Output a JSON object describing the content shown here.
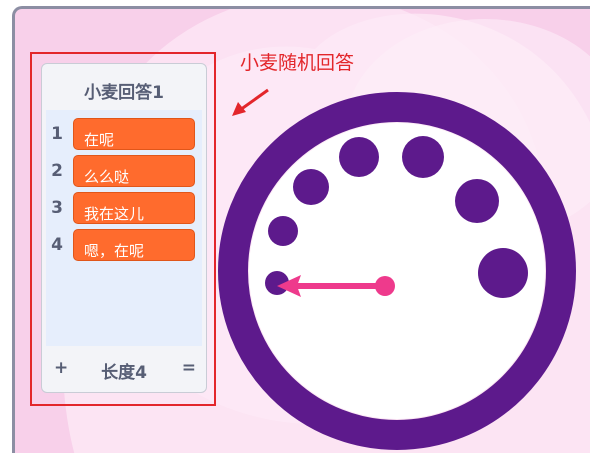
{
  "annotation": {
    "text": "小麦随机回答",
    "color": "#e3262b"
  },
  "list": {
    "title": "小麦回答1",
    "items": [
      {
        "index": "1",
        "value": "在呢"
      },
      {
        "index": "2",
        "value": "么么哒"
      },
      {
        "index": "3",
        "value": "我在这儿"
      },
      {
        "index": "4",
        "value": "嗯，在呢"
      }
    ],
    "footer": {
      "add": "+",
      "length": "长度4",
      "resize": "="
    }
  },
  "colors": {
    "stage_bg": "#f8d0ea",
    "clock": "#5d1a8c",
    "hand": "#ee3a8c",
    "item": "#ff6b2d"
  },
  "icons": {
    "clock": "clock-face-sprite",
    "arrow": "red-arrow-icon"
  }
}
